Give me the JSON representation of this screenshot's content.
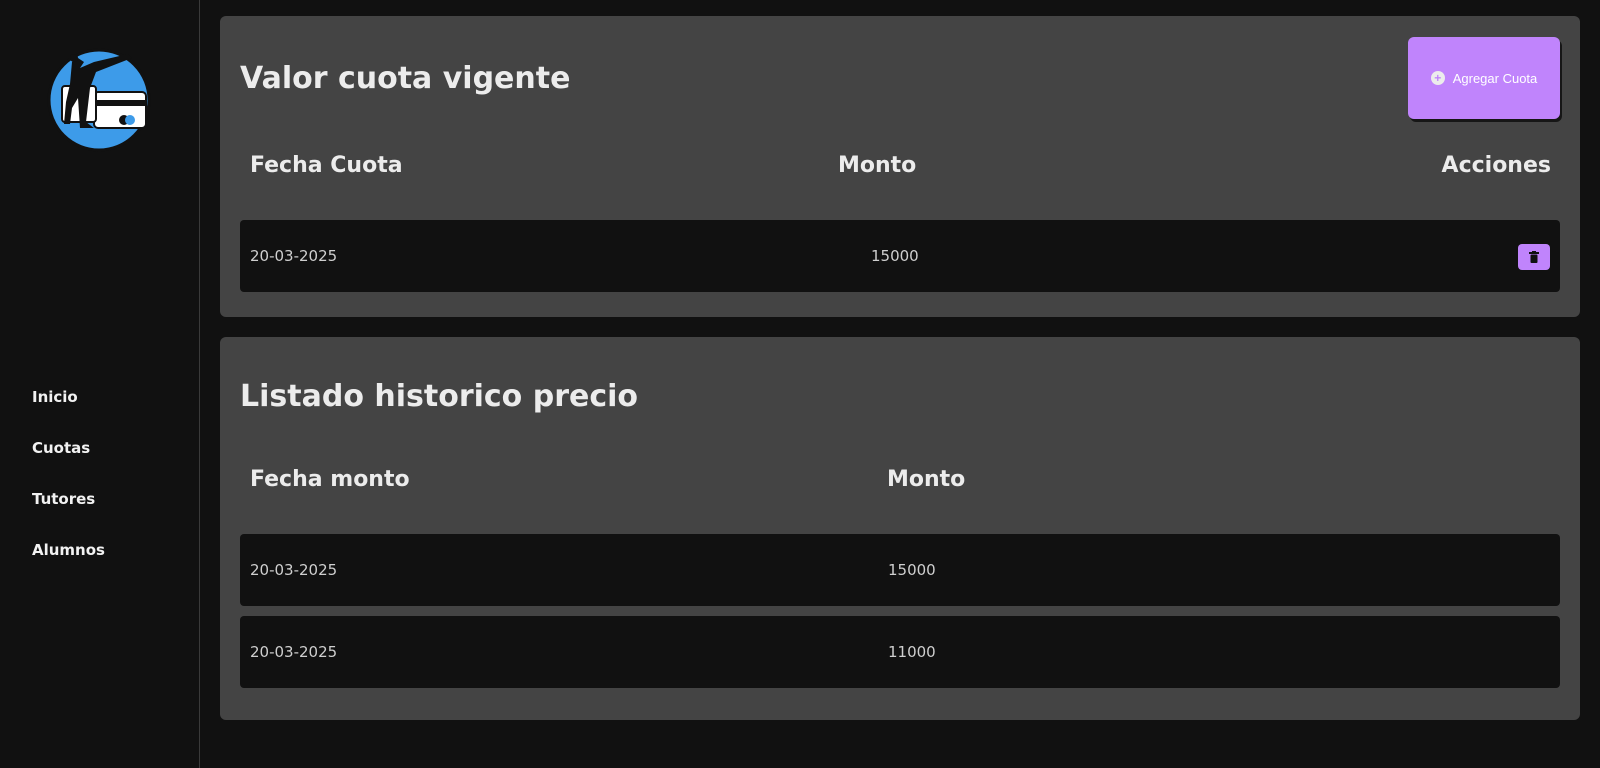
{
  "sidebar": {
    "logo_icon": "karate-kick-card-logo-icon",
    "items": [
      {
        "label": "Inicio"
      },
      {
        "label": "Cuotas"
      },
      {
        "label": "Tutores"
      },
      {
        "label": "Alumnos"
      }
    ]
  },
  "current_fee": {
    "title": "Valor cuota vigente",
    "add_button_label": "Agregar Cuota",
    "add_button_icon": "plus-circle-icon",
    "columns": [
      "Fecha Cuota",
      "Monto",
      "Acciones"
    ],
    "rows": [
      {
        "date": "20-03-2025",
        "amount": "15000",
        "action_icon": "trash-icon"
      }
    ]
  },
  "history": {
    "title": "Listado historico precio",
    "columns": [
      "Fecha monto",
      "Monto"
    ],
    "rows": [
      {
        "date": "20-03-2025",
        "amount": "15000"
      },
      {
        "date": "20-03-2025",
        "amount": "11000"
      }
    ]
  },
  "colors": {
    "background": "#111111",
    "card": "#444444",
    "accent": "#c084fc",
    "logo_blue": "#3d9be9"
  }
}
